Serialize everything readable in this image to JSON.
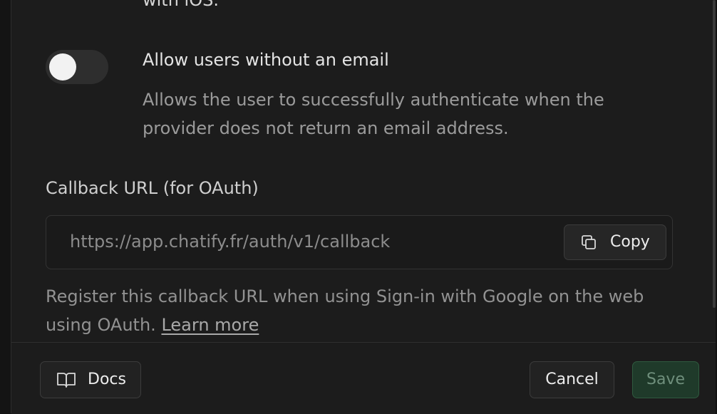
{
  "ios_note": {
    "text": "with iOS."
  },
  "allow_no_email": {
    "title": "Allow users without an email",
    "description": "Allows the user to successfully authenticate when the provider does not return an email address.",
    "enabled": false
  },
  "callback": {
    "label": "Callback URL (for OAuth)",
    "url": "https://app.chatify.fr/auth/v1/callback",
    "copy_label": "Copy",
    "copy_icon": "copy-icon",
    "help_text": "Register this callback URL when using Sign-in with Google on the web using OAuth.",
    "learn_more": "Learn more"
  },
  "footer": {
    "docs_label": "Docs",
    "docs_icon": "book-open-icon",
    "cancel_label": "Cancel",
    "save_label": "Save"
  },
  "colors": {
    "panel_bg": "#1c1c1c",
    "save_bg": "#1f3a2a",
    "save_text": "#6f8f7c"
  }
}
